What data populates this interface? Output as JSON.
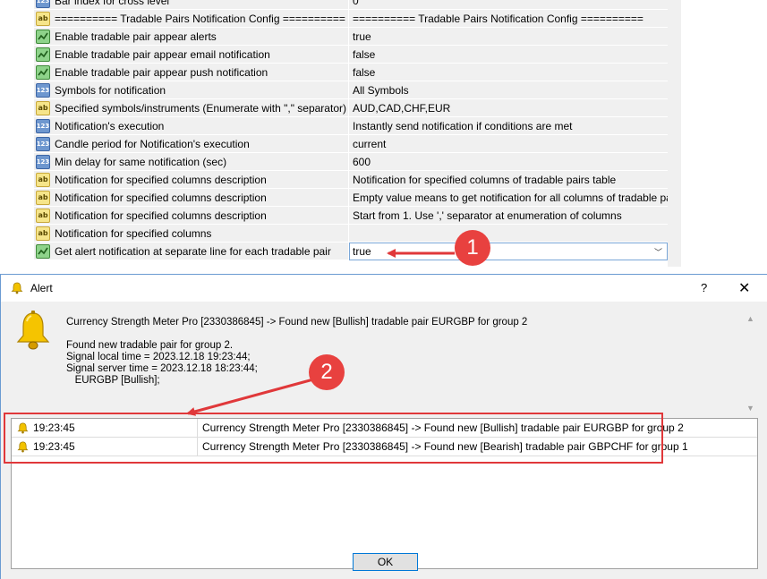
{
  "settings": {
    "rows": [
      {
        "icon": "123",
        "name": "Bar index for cross level",
        "value": "0"
      },
      {
        "icon": "ab",
        "name": "========== Tradable Pairs Notification Config ==========",
        "value": "========== Tradable Pairs Notification Config =========="
      },
      {
        "icon": "bool",
        "name": "Enable tradable pair appear alerts",
        "value": "true"
      },
      {
        "icon": "bool",
        "name": "Enable tradable pair appear email notification",
        "value": "false"
      },
      {
        "icon": "bool",
        "name": "Enable tradable pair appear push notification",
        "value": "false"
      },
      {
        "icon": "123",
        "name": "Symbols for notification",
        "value": "All Symbols"
      },
      {
        "icon": "ab",
        "name": "Specified symbols/instruments (Enumerate with \",\" separator)",
        "value": "AUD,CAD,CHF,EUR"
      },
      {
        "icon": "123",
        "name": "Notification's execution",
        "value": "Instantly send notification if conditions are met"
      },
      {
        "icon": "123",
        "name": "Candle period for Notification's execution",
        "value": "current"
      },
      {
        "icon": "123",
        "name": "Min delay for same notification (sec)",
        "value": "600"
      },
      {
        "icon": "ab",
        "name": "Notification for specified columns description",
        "value": "Notification for specified columns of tradable pairs table"
      },
      {
        "icon": "ab",
        "name": "Notification for specified columns description",
        "value": "Empty value means to get notification for all columns of tradable pairs ta..."
      },
      {
        "icon": "ab",
        "name": "Notification for specified columns description",
        "value": "Start from 1. Use ',' separator at enumeration of columns"
      },
      {
        "icon": "ab",
        "name": "Notification for specified columns",
        "value": ""
      },
      {
        "icon": "bool",
        "name": "Get alert notification at separate line for each tradable pair",
        "value": "true"
      }
    ]
  },
  "dialog": {
    "title": "Alert",
    "help": "?",
    "close": "✕",
    "headline": "Currency Strength Meter Pro [2330386845] -> Found new [Bullish] tradable pair EURGBP for group 2",
    "body": "Found new tradable pair for group 2.\nSignal local time = 2023.12.18 19:23:44;\nSignal server time = 2023.12.18 18:23:44;\n   EURGBP [Bullish];",
    "alerts": [
      {
        "time": "19:23:45",
        "message": "Currency Strength Meter Pro [2330386845] -> Found new [Bullish] tradable pair EURGBP for group 2"
      },
      {
        "time": "19:23:45",
        "message": "Currency Strength Meter Pro [2330386845] -> Found new [Bearish] tradable pair GBPCHF for group 1"
      }
    ],
    "ok_label": "OK"
  },
  "annotations": {
    "badge1": "1",
    "badge2": "2",
    "color": "#e0383a"
  },
  "colors": {
    "row_bg": "#f0f0f0",
    "selection_border": "#7aa7d8",
    "ok_border": "#0078d7"
  }
}
